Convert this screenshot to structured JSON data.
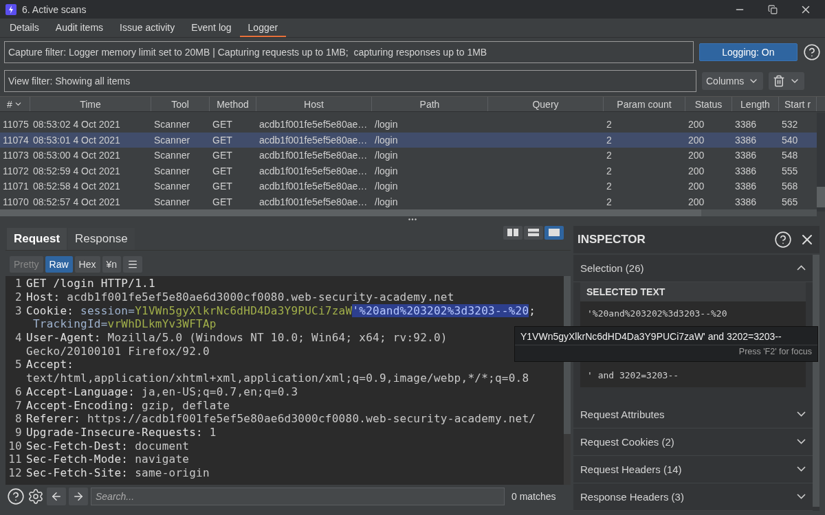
{
  "window": {
    "title": "6. Active scans"
  },
  "tabs": [
    {
      "label": "Details",
      "selected": false
    },
    {
      "label": "Audit items",
      "selected": false
    },
    {
      "label": "Issue activity",
      "selected": false
    },
    {
      "label": "Event log",
      "selected": false
    },
    {
      "label": "Logger",
      "selected": true
    }
  ],
  "capture_filter": "Capture filter: Logger memory limit set to 20MB | Capturing requests up to 1MB;  capturing responses up to 1MB",
  "logging_button": {
    "label": "Logging: On",
    "on": true
  },
  "view_filter": "View filter: Showing all items",
  "columns_button": "Columns",
  "table": {
    "columns": [
      "#",
      "Time",
      "Tool",
      "Method",
      "Host",
      "Path",
      "Query",
      "Param count",
      "Status",
      "Length",
      "Start r"
    ],
    "rows": [
      {
        "number": "11075",
        "time": "08:53:02 4 Oct 2021",
        "tool": "Scanner",
        "method": "GET",
        "host": "acdb1f001fe5ef5e80ae…",
        "path": "/login",
        "param_count": "2",
        "status": "200",
        "length": "3386",
        "start": "532",
        "selected": false
      },
      {
        "number": "11074",
        "time": "08:53:01 4 Oct 2021",
        "tool": "Scanner",
        "method": "GET",
        "host": "acdb1f001fe5ef5e80ae…",
        "path": "/login",
        "param_count": "2",
        "status": "200",
        "length": "3386",
        "start": "540",
        "selected": true
      },
      {
        "number": "11073",
        "time": "08:53:00 4 Oct 2021",
        "tool": "Scanner",
        "method": "GET",
        "host": "acdb1f001fe5ef5e80ae…",
        "path": "/login",
        "param_count": "2",
        "status": "200",
        "length": "3386",
        "start": "548",
        "selected": false
      },
      {
        "number": "11072",
        "time": "08:52:59 4 Oct 2021",
        "tool": "Scanner",
        "method": "GET",
        "host": "acdb1f001fe5ef5e80ae…",
        "path": "/login",
        "param_count": "2",
        "status": "200",
        "length": "3386",
        "start": "555",
        "selected": false
      },
      {
        "number": "11071",
        "time": "08:52:58 4 Oct 2021",
        "tool": "Scanner",
        "method": "GET",
        "host": "acdb1f001fe5ef5e80ae…",
        "path": "/login",
        "param_count": "2",
        "status": "200",
        "length": "3386",
        "start": "568",
        "selected": false
      },
      {
        "number": "11070",
        "time": "08:52:57 4 Oct 2021",
        "tool": "Scanner",
        "method": "GET",
        "host": "acdb1f001fe5ef5e80ae…",
        "path": "/login",
        "param_count": "2",
        "status": "200",
        "length": "3386",
        "start": "565",
        "selected": false
      }
    ]
  },
  "message_panel": {
    "tabs": [
      {
        "label": "Request",
        "selected": true
      },
      {
        "label": "Response",
        "selected": false
      }
    ],
    "layout_modes": [
      {
        "kind": "columns",
        "selected": false
      },
      {
        "kind": "rows",
        "selected": false
      },
      {
        "kind": "single",
        "selected": true
      }
    ],
    "format_buttons": [
      {
        "label": "Pretty",
        "selected": false,
        "disabled": true
      },
      {
        "label": "Raw",
        "selected": true,
        "disabled": false
      },
      {
        "label": "Hex",
        "selected": false,
        "disabled": false
      },
      {
        "label": "¥n",
        "selected": false,
        "disabled": false
      }
    ],
    "lines": [
      {
        "number": "1",
        "rows": [
          [
            {
              "kind": "name",
              "text": "GET /login HTTP/1.1"
            }
          ]
        ]
      },
      {
        "number": "2",
        "rows": [
          [
            {
              "kind": "name",
              "text": "Host: "
            },
            {
              "kind": "value",
              "text": "acdb1f001fe5ef5e80ae6d3000cf0080.web-security-academy.net"
            }
          ]
        ]
      },
      {
        "number": "3",
        "rows": [
          [
            {
              "kind": "name",
              "text": "Cookie: "
            },
            {
              "kind": "param",
              "text": "session="
            },
            {
              "kind": "param_value",
              "text": "Y1VWn5gyXlkrNc6dHD4Da3Y9PUCi7zaW"
            },
            {
              "kind": "selection",
              "text": "'%20and%203202%3d3203--%20"
            },
            {
              "kind": "name",
              "text": ";"
            }
          ],
          [
            {
              "kind": "param",
              "text": " TrackingId="
            },
            {
              "kind": "param_value",
              "text": "vrWhDLkmYv3WFTAp"
            }
          ]
        ]
      },
      {
        "number": "4",
        "rows": [
          [
            {
              "kind": "name",
              "text": "User-Agent: "
            },
            {
              "kind": "value",
              "text": "Mozilla/5.0 (Windows NT 10.0; Win64; x64; rv:92.0)"
            }
          ],
          [
            {
              "kind": "value",
              "text": "Gecko/20100101 Firefox/92.0"
            }
          ]
        ]
      },
      {
        "number": "5",
        "rows": [
          [
            {
              "kind": "name",
              "text": "Accept:"
            }
          ],
          [
            {
              "kind": "value",
              "text": "text/html,application/xhtml+xml,application/xml;q=0.9,image/webp,*/*;q=0.8"
            }
          ]
        ]
      },
      {
        "number": "6",
        "rows": [
          [
            {
              "kind": "name",
              "text": "Accept-Language: "
            },
            {
              "kind": "value",
              "text": "ja,en-US;q=0.7,en;q=0.3"
            }
          ]
        ]
      },
      {
        "number": "7",
        "rows": [
          [
            {
              "kind": "name",
              "text": "Accept-Encoding: "
            },
            {
              "kind": "value",
              "text": "gzip, deflate"
            }
          ]
        ]
      },
      {
        "number": "8",
        "rows": [
          [
            {
              "kind": "name",
              "text": "Referer: "
            },
            {
              "kind": "value",
              "text": "https://acdb1f001fe5ef5e80ae6d3000cf0080.web-security-academy.net/"
            }
          ]
        ]
      },
      {
        "number": "9",
        "rows": [
          [
            {
              "kind": "name",
              "text": "Upgrade-Insecure-Requests: "
            },
            {
              "kind": "value",
              "text": "1"
            }
          ]
        ]
      },
      {
        "number": "10",
        "rows": [
          [
            {
              "kind": "name",
              "text": "Sec-Fetch-Dest: "
            },
            {
              "kind": "value",
              "text": "document"
            }
          ]
        ]
      },
      {
        "number": "11",
        "rows": [
          [
            {
              "kind": "name",
              "text": "Sec-Fetch-Mode: "
            },
            {
              "kind": "value",
              "text": "navigate"
            }
          ]
        ]
      },
      {
        "number": "12",
        "rows": [
          [
            {
              "kind": "name",
              "text": "Sec-Fetch-Site: "
            },
            {
              "kind": "value",
              "text": "same-origin"
            }
          ]
        ]
      }
    ],
    "search": {
      "placeholder": "Search...",
      "matches": "0 matches"
    }
  },
  "inspector": {
    "title": "INSPECTOR",
    "sections": [
      {
        "label": "Selection (26)",
        "expanded": true,
        "heading": "SELECTED TEXT",
        "selected_text": "'%20and%203202%3d3203--%20",
        "decoded_text": "' and 3202=3203--"
      },
      {
        "label": "Request Attributes",
        "expanded": false
      },
      {
        "label": "Request Cookies (2)",
        "expanded": false
      },
      {
        "label": "Request Headers (14)",
        "expanded": false
      },
      {
        "label": "Response Headers (3)",
        "expanded": false
      }
    ]
  },
  "tooltip": {
    "text": "Y1VWn5gyXlkrNc6dHD4Da3Y9PUCi7zaW' and 3202=3203--",
    "hint": "Press 'F2' for focus"
  }
}
